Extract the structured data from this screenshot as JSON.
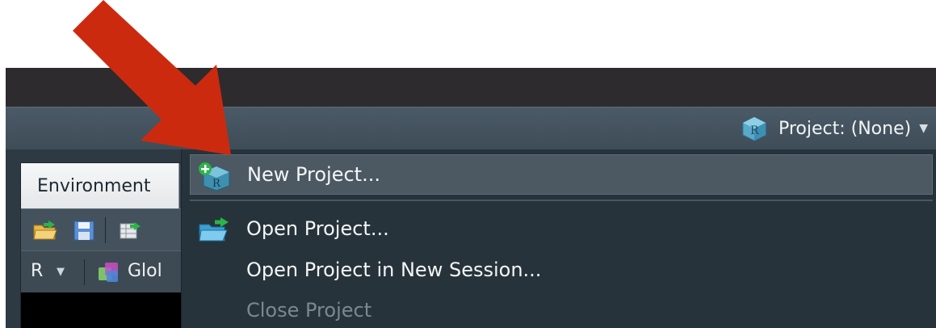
{
  "toolbar": {
    "project_label": "Project: (None)",
    "project_icon": "r-project-cube-icon"
  },
  "env_pane": {
    "tab_label": "Environment",
    "language": "R",
    "scope_label_partial": "Glol"
  },
  "project_menu": {
    "items": [
      {
        "label": "New Project...",
        "icon": "new-project-icon",
        "state": "highlighted"
      },
      {
        "label": "Open Project...",
        "icon": "open-folder-icon",
        "state": "enabled"
      },
      {
        "label": "Open Project in New Session...",
        "icon": "",
        "state": "enabled"
      },
      {
        "label": "Close Project",
        "icon": "",
        "state": "disabled"
      }
    ]
  },
  "annotation": {
    "arrow_color": "#cc2a0f",
    "arrow_points_to": "New Project..."
  },
  "colors": {
    "titlebar": "#2d2b2e",
    "toolbar": "#44535e",
    "menu_bg": "#27333b",
    "menu_highlight": "#4c5963"
  }
}
